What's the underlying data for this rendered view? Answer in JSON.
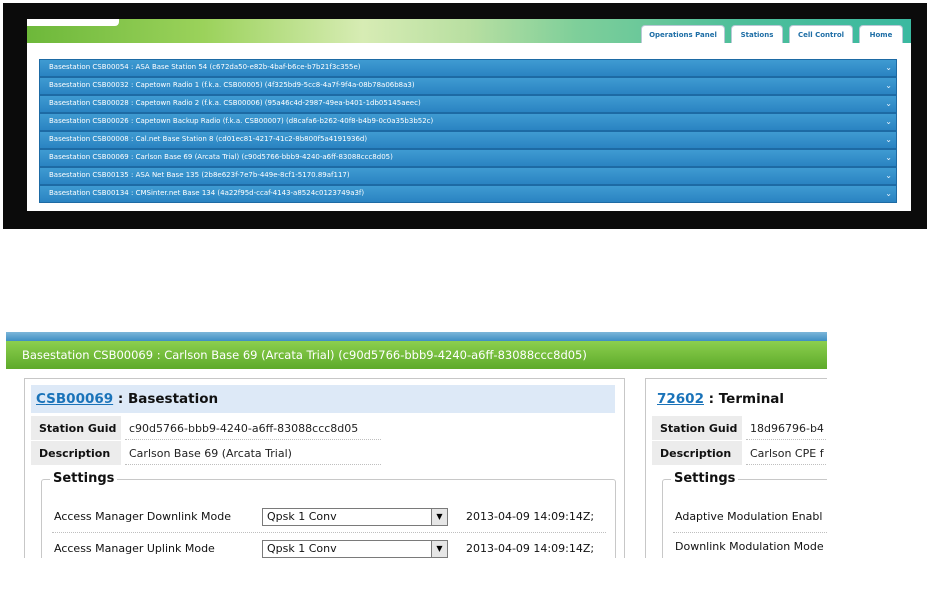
{
  "top": {
    "tabs": [
      "Operations Panel",
      "Stations",
      "Cell Control",
      "Home"
    ],
    "basestations": [
      "Basestation CSB00054 : ASA Base Station 54 (c672da50-e82b-4baf-b6ce-b7b21f3c355e)",
      "Basestation CSB00032 : Capetown Radio 1 (f.k.a. CSB00005) (4f325bd9-5cc8-4a7f-9f4a-08b78a06b8a3)",
      "Basestation CSB00028 : Capetown Radio 2 (f.k.a. CSB00006) (95a46c4d-2987-49ea-b401-1db05145aeec)",
      "Basestation CSB00026 : Capetown Backup Radio (f.k.a. CSB00007) (d8cafa6-b262-40f8-b4b9-0c0a35b3b52c)",
      "Basestation CSB00008 : Cal.net Base Station 8 (cd01ec81-4217-41c2-8b800f5a4191936d)",
      "Basestation CSB00069 : Carlson Base 69 (Arcata Trial) (c90d5766-bbb9-4240-a6ff-83088ccc8d05)",
      "Basestation CSB00135 : ASA Net Base 135 (2b8e623f-7e7b-449e-8cf1-5170.89af117)",
      "Basestation CSB00134 : CMSinter.net Base 134 (4a22f95d-ccaf-4143-a8524c0123749a3f)"
    ],
    "chevron": "⌄"
  },
  "bottom": {
    "header": "Basestation CSB00069 : Carlson Base 69 (Arcata Trial) (c90d5766-bbb9-4240-a6ff-83088ccc8d05)",
    "left": {
      "id_link": "CSB00069",
      "type_label": " : Basestation",
      "guid_label": "Station Guid",
      "guid_value": "c90d5766-bbb9-4240-a6ff-83088ccc8d05",
      "desc_label": "Description",
      "desc_value": "Carlson Base 69 (Arcata Trial)",
      "settings_legend": "Settings",
      "settings": [
        {
          "label": "Access Manager Downlink Mode",
          "value": "Qpsk 1 Conv",
          "timestamp": "2013-04-09 14:09:14Z;"
        },
        {
          "label": "Access Manager Uplink Mode",
          "value": "Qpsk 1 Conv",
          "timestamp": "2013-04-09 14:09:14Z;"
        }
      ]
    },
    "right": {
      "id_link": "72602",
      "type_label": " : Terminal",
      "guid_label": "Station Guid",
      "guid_value": "18d96796-b4",
      "desc_label": "Description",
      "desc_value": "Carlson CPE f",
      "settings_legend": "Settings",
      "settings": [
        "Adaptive Modulation Enabl",
        "Downlink Modulation Mode"
      ]
    },
    "dropdown_arrow": "▼"
  }
}
